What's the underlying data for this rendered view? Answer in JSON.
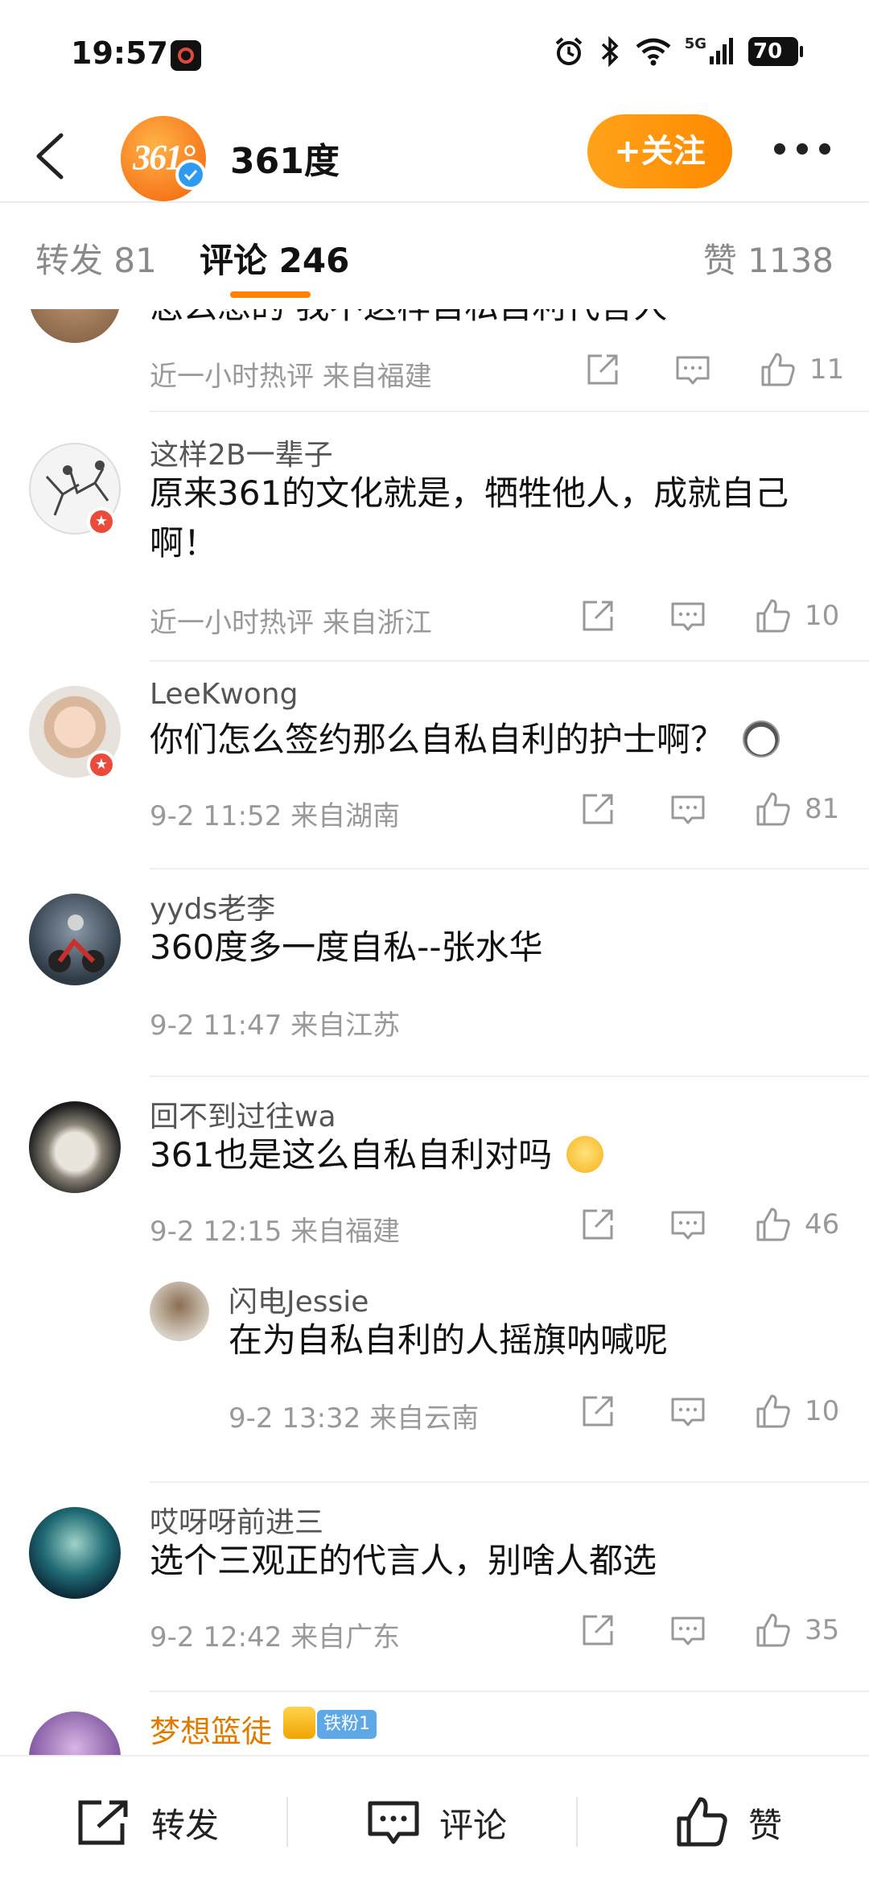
{
  "status_bar": {
    "time": "19:57",
    "network": "5G",
    "battery": "70"
  },
  "header": {
    "avatar_text": "361°",
    "name": "361度",
    "follow_label": "+关注"
  },
  "tabs": {
    "repost": "转发 81",
    "comment": "评论 246",
    "like": "赞 1138"
  },
  "comments": [
    {
      "partial_text": "怎么想的 我不这样自私自利代言人",
      "meta": "近一小时热评  来自福建",
      "likes": "11"
    },
    {
      "username": "这样2B一辈子",
      "text": "原来361的文化就是，牺牲他人，成就自己啊！",
      "meta": "近一小时热评  来自浙江",
      "likes": "10"
    },
    {
      "username": "LeeKwong",
      "text": "你们怎么签约那么自私自利的护士啊？",
      "meta": "9-2 11:52  来自湖南",
      "likes": "81"
    },
    {
      "username": "yyds老李",
      "text": "360度多一度自私--张水华",
      "meta": "9-2 11:47  来自江苏"
    },
    {
      "username": "回不到过往wa",
      "text": "361也是这么自私自利对吗",
      "meta": "9-2 12:15  来自福建",
      "likes": "46",
      "reply": {
        "username": "闪电Jessie",
        "text": "在为自私自利的人摇旗呐喊呢",
        "meta": "9-2 13:32  来自云南",
        "likes": "10"
      }
    },
    {
      "username": "哎呀呀前进三",
      "text": "选个三观正的代言人，别啥人都选",
      "meta": "9-2 12:42  来自广东",
      "likes": "35"
    },
    {
      "username": "梦想篮徒",
      "fan_badge": "铁粉1"
    }
  ],
  "bottom_bar": {
    "repost": "转发",
    "comment": "评论",
    "like": "赞"
  },
  "colors": {
    "accent_orange": "#ff8200",
    "verified_blue": "#2f9bf0",
    "meta_gray": "#999999",
    "vip_red": "#ea4b3a",
    "fan_gold": "#e07b00"
  }
}
